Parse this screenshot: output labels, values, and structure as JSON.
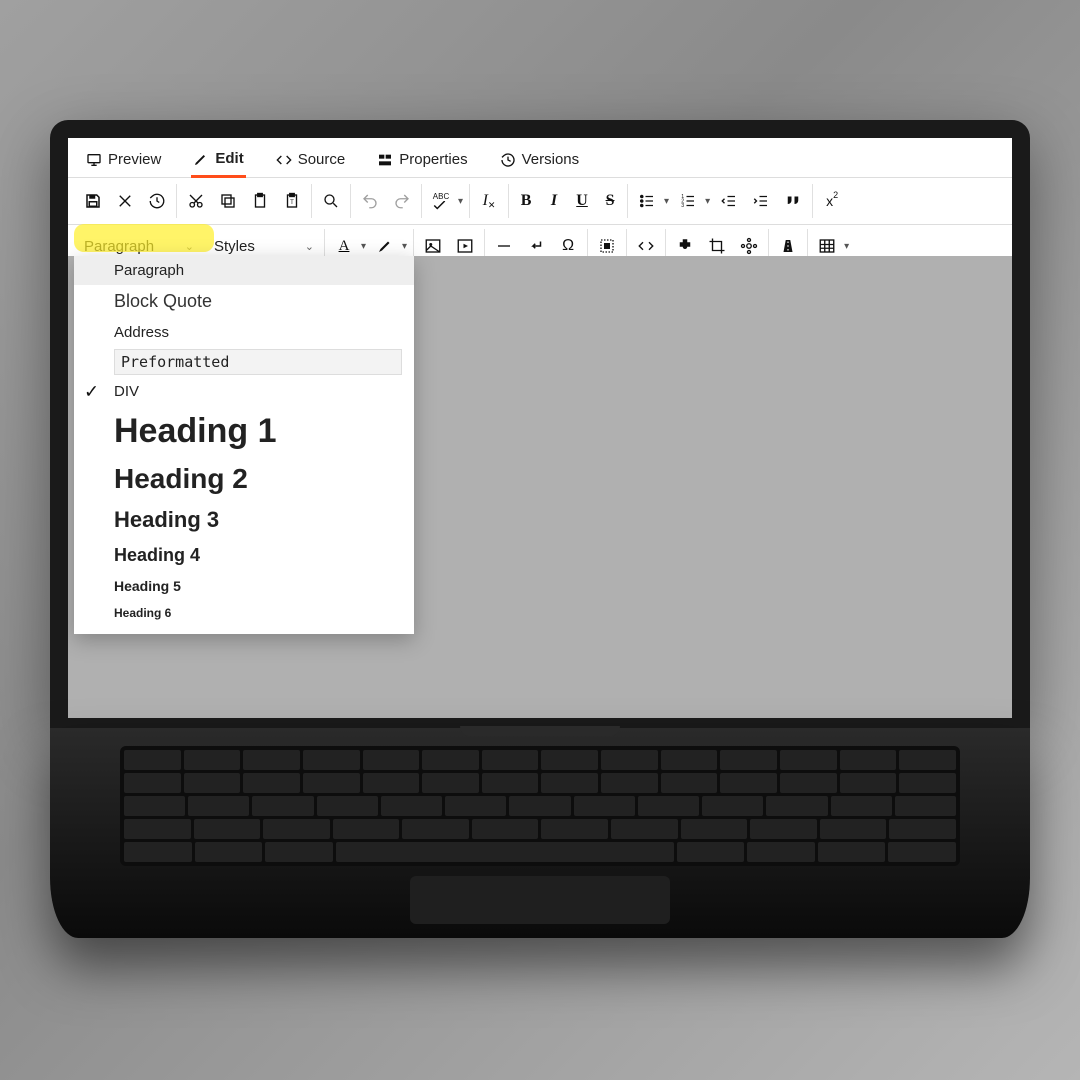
{
  "tabs": {
    "preview": "Preview",
    "edit": "Edit",
    "source": "Source",
    "properties": "Properties",
    "versions": "Versions",
    "active": "edit"
  },
  "combo": {
    "format": "Paragraph",
    "styles": "Styles"
  },
  "format_menu": {
    "paragraph": "Paragraph",
    "block_quote": "Block Quote",
    "address": "Address",
    "preformatted": "Preformatted",
    "div": "DIV",
    "h1": "Heading 1",
    "h2": "Heading 2",
    "h3": "Heading 3",
    "h4": "Heading 4",
    "h5": "Heading 5",
    "h6": "Heading 6",
    "selected": "div"
  },
  "toolbar_labels": {
    "abc": "ABC"
  }
}
